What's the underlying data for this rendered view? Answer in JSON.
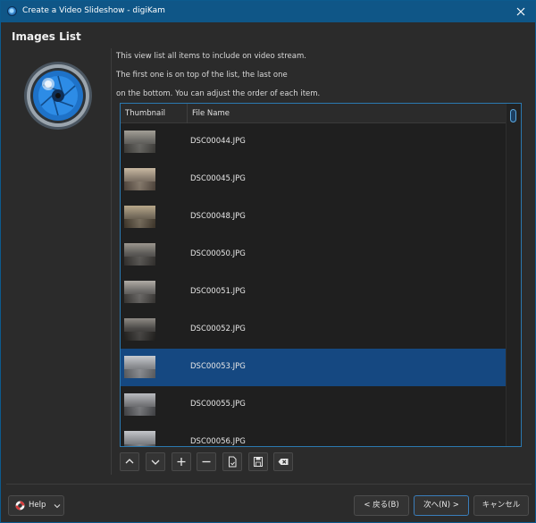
{
  "window": {
    "title": "Create a Video Slideshow - digiKam"
  },
  "page": {
    "title": "Images List"
  },
  "description": [
    "This view list all items to include on video stream.",
    "The first one is on top of the list, the last one",
    "on the bottom. You can adjust the order of each item."
  ],
  "list": {
    "headers": {
      "thumbnail": "Thumbnail",
      "file_name": "File Name"
    },
    "items": [
      {
        "name": "DSC00044.JPG",
        "selected": false
      },
      {
        "name": "DSC00045.JPG",
        "selected": false
      },
      {
        "name": "DSC00048.JPG",
        "selected": false
      },
      {
        "name": "DSC00050.JPG",
        "selected": false
      },
      {
        "name": "DSC00051.JPG",
        "selected": false
      },
      {
        "name": "DSC00052.JPG",
        "selected": false
      },
      {
        "name": "DSC00053.JPG",
        "selected": true
      },
      {
        "name": "DSC00055.JPG",
        "selected": false
      },
      {
        "name": "DSC00056.JPG",
        "selected": false
      }
    ]
  },
  "toolbar": {
    "buttons": [
      "move-up-icon",
      "move-down-icon",
      "add-icon",
      "remove-icon",
      "load-list-icon",
      "save-list-icon",
      "clear-list-icon"
    ]
  },
  "footer": {
    "help_label": "Help",
    "back_label": "< 戻る(B)",
    "next_label": "次へ(N) >",
    "cancel_label": "キャンセル"
  },
  "colors": {
    "titlebar": "#0f5687",
    "selection": "#154881",
    "list_border": "#2b79b0",
    "background": "#2b2b2b"
  }
}
